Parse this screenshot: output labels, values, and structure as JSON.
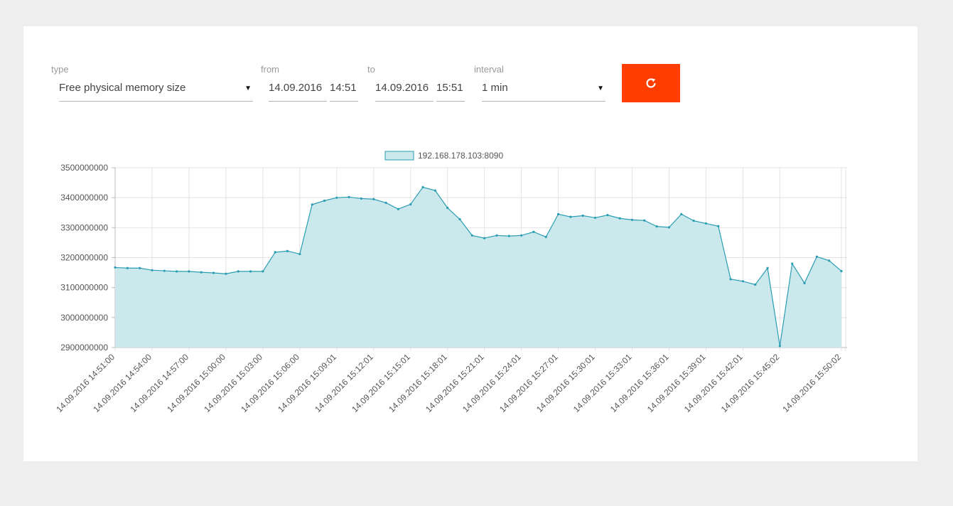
{
  "filters": {
    "type": {
      "label": "type",
      "value": "Free physical memory size"
    },
    "from": {
      "label": "from",
      "date": "14.09.2016",
      "time": "14:51"
    },
    "to": {
      "label": "to",
      "date": "14.09.2016",
      "time": "15:51"
    },
    "interval": {
      "label": "interval",
      "value": "1 min"
    },
    "refresh_icon": "refresh-icon"
  },
  "colors": {
    "accent": "#ff3d00",
    "series_line": "#2a9db2",
    "series_fill": "#cbe8ed",
    "background": "#eeeeee"
  },
  "chart_data": {
    "type": "area",
    "legend": [
      "192.168.178.103:8090"
    ],
    "legend_position": "top-center",
    "grid": true,
    "ylim": [
      2900000000,
      3500000000
    ],
    "yticks": [
      "3500000000",
      "3400000000",
      "3300000000",
      "3200000000",
      "3100000000",
      "3000000000",
      "2900000000"
    ],
    "xtick_labels": [
      "14.09.2016 14:51:00",
      "14.09.2016 14:54:00",
      "14.09.2016 14:57:00",
      "14.09.2016 15:00:00",
      "14.09.2016 15:03:00",
      "14.09.2016 15:06:00",
      "14.09.2016 15:09:01",
      "14.09.2016 15:12:01",
      "14.09.2016 15:15:01",
      "14.09.2016 15:18:01",
      "14.09.2016 15:21:01",
      "14.09.2016 15:24:01",
      "14.09.2016 15:27:01",
      "14.09.2016 15:30:01",
      "14.09.2016 15:33:01",
      "14.09.2016 15:36:01",
      "14.09.2016 15:39:01",
      "14.09.2016 15:42:01",
      "14.09.2016 15:45:02",
      "14.09.2016 15:50:02"
    ],
    "xtick_index": [
      0,
      3,
      6,
      9,
      12,
      15,
      18,
      21,
      24,
      27,
      30,
      33,
      36,
      39,
      42,
      45,
      48,
      51,
      54,
      59
    ],
    "series": [
      {
        "name": "192.168.178.103:8090",
        "values": [
          3167000000,
          3165000000,
          3165000000,
          3158000000,
          3156000000,
          3154000000,
          3154000000,
          3151000000,
          3149000000,
          3146000000,
          3154000000,
          3154000000,
          3154000000,
          3218000000,
          3222000000,
          3212000000,
          3377000000,
          3390000000,
          3400000000,
          3402000000,
          3397000000,
          3395000000,
          3383000000,
          3362000000,
          3378000000,
          3435000000,
          3424000000,
          3366000000,
          3328000000,
          3274000000,
          3265000000,
          3274000000,
          3272000000,
          3274000000,
          3286000000,
          3269000000,
          3345000000,
          3336000000,
          3340000000,
          3333000000,
          3342000000,
          3331000000,
          3326000000,
          3324000000,
          3304000000,
          3301000000,
          3345000000,
          3323000000,
          3314000000,
          3305000000,
          3128000000,
          3121000000,
          3110000000,
          3165000000,
          2905000000,
          3180000000,
          3115000000,
          3203000000,
          3190000000,
          3155000000
        ]
      }
    ]
  }
}
